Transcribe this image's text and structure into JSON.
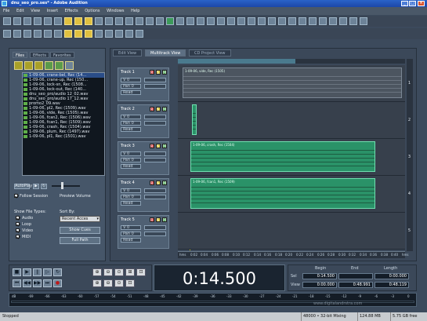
{
  "window": {
    "title": "dnu_seo_pro.ses* - Adobe Audition"
  },
  "menu": [
    "File",
    "Edit",
    "View",
    "Insert",
    "Effects",
    "Options",
    "Windows",
    "Help"
  ],
  "left_panel": {
    "tabs": [
      "Files",
      "Effects",
      "Favorites"
    ],
    "files": [
      "1-09-06, crane-bel, Rec (14...",
      "1-09-06, crane-up, Rec (150...",
      "1-09-06, lock-sn, Rec (1508...",
      "1-09-06, lock-out, Rec (140...",
      "dnu_seo_pro/audio 12_02.wav",
      "dnu_seo_pro/audio 17_12.wav",
      "promo2_09.wav",
      "1-09-06, pl2, Rec (1509).wav",
      "1-09-06, vide, Rec (1505).wav",
      "1-09-06, fcan2, Rec (1506).wav",
      "1-09-06, fcan1, Rec (1509).wav",
      "1-09-06, crash, Rec (1504).wav",
      "1-09-06, plum, Rec (1497).wav",
      "1-09-06, pl1, Rec (1501).wav"
    ],
    "auto_play": "AutoPlay",
    "follow_session": "Follow Session",
    "preview_volume": "Preview Volume",
    "show_file_types": "Show File Types:",
    "sort_by": "Sort By:",
    "sort_value": "Recent Acces",
    "types": [
      "Audio",
      "Loop",
      "Video",
      "MIDI"
    ],
    "show_cues": "Show Cues",
    "full_path": "Full Path"
  },
  "view_tabs": [
    "Edit View",
    "Multitrack View",
    "CD Project View"
  ],
  "tracks": [
    {
      "name": "Track 1",
      "vol": "V 0",
      "pan": "Pan 0",
      "read": "Read",
      "mute": "M",
      "solo": "S",
      "rec": "R",
      "lane_num": "1",
      "clip": "1-09-06, vide, Rec (1505)"
    },
    {
      "name": "Track 2",
      "vol": "V 0",
      "pan": "Pan 0",
      "read": "Read",
      "mute": "M",
      "solo": "S",
      "rec": "R",
      "lane_num": "2",
      "clip": ""
    },
    {
      "name": "Track 3",
      "vol": "V 0",
      "pan": "Pan 0",
      "read": "Read",
      "mute": "M",
      "solo": "S",
      "rec": "R",
      "lane_num": "3",
      "clip": "1-09-06, crash, Rec (1504)"
    },
    {
      "name": "Track 4",
      "vol": "V 0",
      "pan": "Pan 0",
      "read": "Read",
      "mute": "M",
      "solo": "S",
      "rec": "R",
      "lane_num": "4",
      "clip": "1-09-06, fcan1, Rec (1509)"
    },
    {
      "name": "Track 5",
      "vol": "V 0",
      "pan": "Pan 0",
      "read": "Read",
      "mute": "M",
      "solo": "S",
      "rec": "R",
      "lane_num": "5",
      "clip": ""
    }
  ],
  "ruler_ticks": [
    "hms",
    "0:02",
    "0:04",
    "0:06",
    "0:08",
    "0:10",
    "0:12",
    "0:14",
    "0:16",
    "0:18",
    "0:20",
    "0:22",
    "0:24",
    "0:26",
    "0:28",
    "0:30",
    "0:32",
    "0:34",
    "0:36",
    "0:38",
    "0:40",
    "hms"
  ],
  "time_display": "0:14.500",
  "selection": {
    "headers": [
      "Begin",
      "End",
      "Length"
    ],
    "sel_label": "Sel",
    "view_label": "View",
    "sel": [
      "0:14.500",
      "",
      "0:00.000"
    ],
    "view": [
      "0:00.000",
      "0:48.991",
      "0:48.119"
    ]
  },
  "level_ticks": [
    "dB",
    "-69",
    "-66",
    "-63",
    "-60",
    "-57",
    "-54",
    "-51",
    "-48",
    "-45",
    "-42",
    "-39",
    "-36",
    "-33",
    "-30",
    "-27",
    "-24",
    "-21",
    "-18",
    "-15",
    "-12",
    "-9",
    "-6",
    "-3",
    "0"
  ],
  "status": {
    "left": "Stopped",
    "rate": "48000 • 32-bit Mixing",
    "mem": "124.88 MB",
    "free": "5.75 GB free"
  },
  "watermark": "www.digitalandrstra.com"
}
